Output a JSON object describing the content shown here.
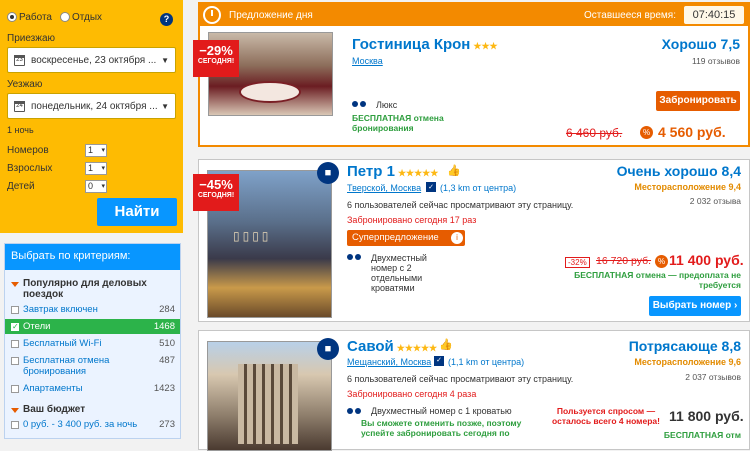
{
  "search": {
    "purpose_work": "Работа",
    "purpose_leisure": "Отдых",
    "help_icon": "?",
    "checkin_label": "Приезжаю",
    "checkin_date": "воскресенье, 23 октября ...",
    "checkin_day": "23",
    "checkout_label": "Уезжаю",
    "checkout_date": "понедельник, 24 октября ...",
    "checkout_day": "24",
    "nights": "1 ночь",
    "rooms_label": "Номеров",
    "rooms": "1",
    "adults_label": "Взрослых",
    "adults": "1",
    "children_label": "Детей",
    "children": "0",
    "find_label": "Найти"
  },
  "filters": {
    "title": "Выбрать по критериям:",
    "group1": "Популярно для деловых поездок",
    "items": [
      {
        "label": "Завтрак включен",
        "count": "284"
      },
      {
        "label": "Отели",
        "count": "1468"
      },
      {
        "label": "Бесплатный Wi-Fi",
        "count": "510"
      },
      {
        "label": "Бесплатная отмена бронирования",
        "count": "487"
      },
      {
        "label": "Апартаменты",
        "count": "1423"
      }
    ],
    "group2": "Ваш бюджет",
    "budget": {
      "label": "0 руб. - 3 400 руб. за ночь",
      "count": "273"
    }
  },
  "deal": {
    "header": "Предложение дня",
    "timer_label": "Оставшееся время:",
    "timer": "07:40:15",
    "discount": "−29%",
    "today": "СЕГОДНЯ!",
    "name": "Гостиница Крон",
    "stars": "★★★",
    "city": "Москва",
    "score": "Хорошо 7,5",
    "reviews": "119 отзывов",
    "room": "Люкс",
    "free": "БЕСПЛАТНАЯ отмена бронирования",
    "book": "Забронировать",
    "old_price": "6 460 руб.",
    "new_price": "4 560 руб."
  },
  "h1": {
    "discount": "−45%",
    "today": "СЕГОДНЯ!",
    "name": "Петр 1",
    "stars": "★★★★★",
    "city": "Тверской, Москва",
    "distance": "(1,3 km от центра)",
    "viewers": "6 пользователей сейчас просматривают эту страницу.",
    "booked": "Забронировано сегодня 17 раз",
    "super": "Суперпредложение",
    "room": "Двухместный номер с 2 отдельными кроватями",
    "score": "Очень хорошо 8,4",
    "location": "Месторасположение 9,4",
    "reviews": "2 032 отзыва",
    "pct": "-32%",
    "old_price": "16 720 руб.",
    "new_price": "11 400 руб.",
    "free": "БЕСПЛАТНАЯ отмена — предоплата не требуется",
    "select": "Выбрать номер"
  },
  "h2": {
    "name": "Савой",
    "stars": "★★★★★",
    "city": "Мещанский, Москва",
    "distance": "(1,1 km от центра)",
    "viewers": "6 пользователей сейчас просматривают эту страницу.",
    "booked": "Забронировано сегодня 4 раза",
    "room": "Двухместный номер с 1 кроватью",
    "room_note": "Вы сможете отменить позже, поэтому успейте забронировать сегодня по",
    "score": "Потрясающе 8,8",
    "location": "Месторасположение 9,6",
    "reviews": "2 037 отзывов",
    "demand": "Пользуется спросом — осталось всего 4 номера!",
    "new_price": "11 800 руб.",
    "free_short": "БЕСПЛАТНАЯ отм"
  }
}
